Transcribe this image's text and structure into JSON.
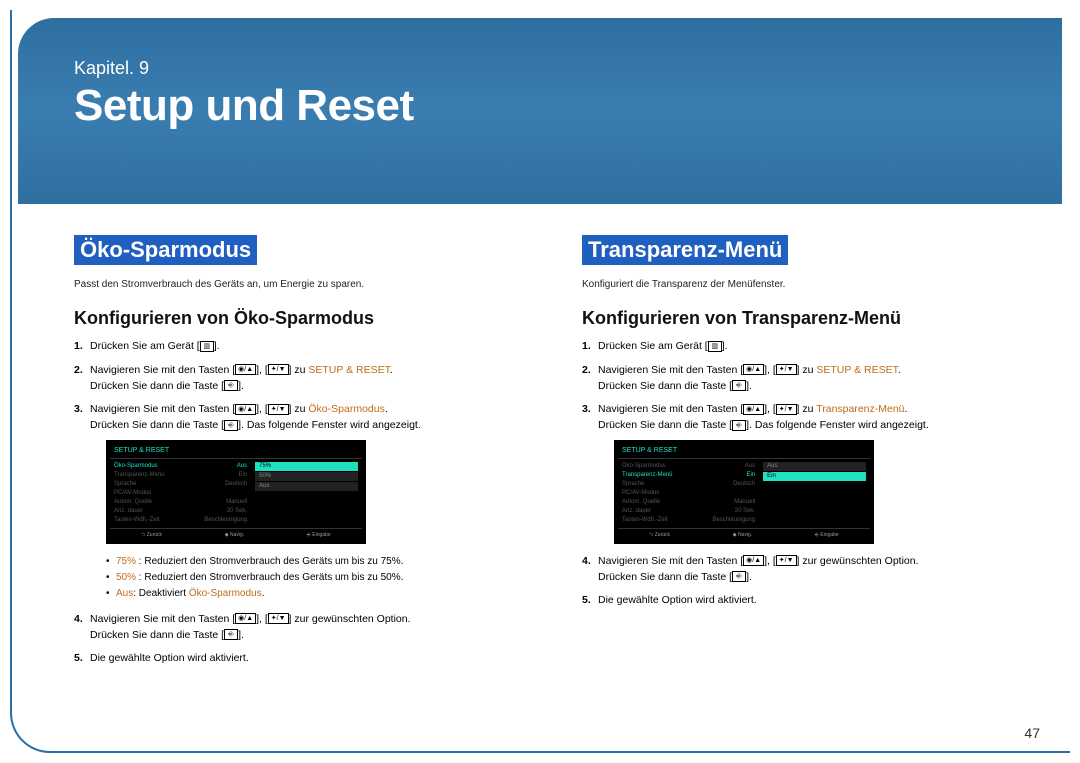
{
  "chapter": {
    "label": "Kapitel. 9",
    "title": "Setup und Reset"
  },
  "page_number": "47",
  "icons": {
    "menu": "▥",
    "up": "◉/▲",
    "down": "✦/▼",
    "enter": "⎆"
  },
  "left": {
    "heading": "Öko-Sparmodus",
    "desc": "Passt den Stromverbrauch des Geräts an, um Energie zu sparen.",
    "sub": "Konfigurieren von Öko-Sparmodus",
    "steps": {
      "s1a": "Drücken Sie am Gerät [",
      "s1b": "].",
      "s2a": "Navigieren Sie mit den Tasten [",
      "s2b": "], [",
      "s2c": "] zu ",
      "s2hl": "SETUP & RESET",
      "s2d": "Drücken Sie dann die Taste [",
      "s2e": "].",
      "s3a": "Navigieren Sie mit den Tasten [",
      "s3b": "], [",
      "s3c": "] zu ",
      "s3hl": "Öko-Sparmodus",
      "s3d": "Drücken Sie dann die Taste [",
      "s3e": "]. Das folgende Fenster wird angezeigt.",
      "s4a": "Navigieren Sie mit den Tasten [",
      "s4b": "], [",
      "s4c": "] zur gewünschten Option.",
      "s4d": "Drücken Sie dann die Taste [",
      "s4e": "].",
      "s5": "Die gewählte Option wird aktiviert."
    },
    "bullets": [
      {
        "hl": "75%",
        "text": " : Reduziert den Stromverbrauch des Geräts um bis zu 75%."
      },
      {
        "hl": "50%",
        "text": " : Reduziert den Stromverbrauch des Geräts um bis zu 50%."
      },
      {
        "hl": "Aus",
        "text": ": Deaktiviert ",
        "hl2": "Öko-Sparmodus",
        "text2": "."
      }
    ],
    "osd": {
      "title": "SETUP & RESET",
      "rows": [
        {
          "label": "Öko-Sparmodus",
          "val": "Aus",
          "active": true
        },
        {
          "label": "Transparenz-Menü",
          "val": "Ein"
        },
        {
          "label": "Sprache",
          "val": "Deutsch"
        },
        {
          "label": "PC/AV-Modus",
          "val": ""
        },
        {
          "label": "Autom. Quelle",
          "val": "Manuell"
        },
        {
          "label": "Anz. dauer",
          "val": "20 Sek."
        },
        {
          "label": "Tasten-Wdh.-Zeit",
          "val": "Beschleunigung"
        }
      ],
      "opts": [
        "75%",
        "50%",
        "Aus"
      ],
      "footer": [
        "⮌ Zurück",
        "◆ Navig.",
        "⎆ Eingabe"
      ]
    }
  },
  "right": {
    "heading": "Transparenz-Menü",
    "desc": "Konfiguriert die Transparenz der Menüfenster.",
    "sub": "Konfigurieren von Transparenz-Menü",
    "steps": {
      "s1a": "Drücken Sie am Gerät [",
      "s1b": "].",
      "s2a": "Navigieren Sie mit den Tasten [",
      "s2b": "], [",
      "s2c": "] zu ",
      "s2hl": "SETUP & RESET",
      "s2d": "Drücken Sie dann die Taste [",
      "s2e": "].",
      "s3a": "Navigieren Sie mit den Tasten [",
      "s3b": "], [",
      "s3c": "] zu ",
      "s3hl": "Transparenz-Menü",
      "s3d": "Drücken Sie dann die Taste [",
      "s3e": "]. Das folgende Fenster wird angezeigt.",
      "s4a": "Navigieren Sie mit den Tasten [",
      "s4b": "], [",
      "s4c": "] zur gewünschten Option.",
      "s4d": "Drücken Sie dann die Taste [",
      "s4e": "].",
      "s5": "Die gewählte Option wird aktiviert."
    },
    "osd": {
      "title": "SETUP & RESET",
      "rows": [
        {
          "label": "Öko-Sparmodus",
          "val": "Aus"
        },
        {
          "label": "Transparenz-Menü",
          "val": "Ein",
          "active": true
        },
        {
          "label": "Sprache",
          "val": "Deutsch"
        },
        {
          "label": "PC/AV-Modus",
          "val": ""
        },
        {
          "label": "Autom. Quelle",
          "val": "Manuell"
        },
        {
          "label": "Anz. dauer",
          "val": "20 Sek."
        },
        {
          "label": "Tasten-Wdh.-Zeit",
          "val": "Beschleunigung"
        }
      ],
      "opts": [
        "Aus",
        "Ein"
      ],
      "footer": [
        "⮌ Zurück",
        "◆ Navig.",
        "⎆ Eingabe"
      ]
    }
  }
}
